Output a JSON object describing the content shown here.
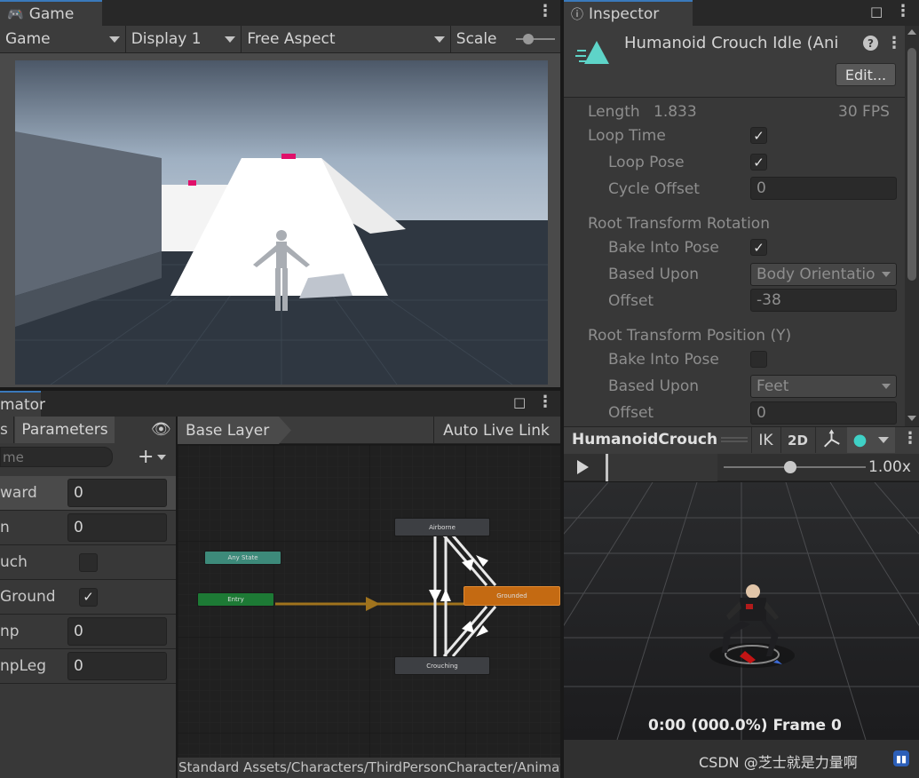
{
  "game": {
    "tab_label": "Game",
    "view_dropdown": "Game",
    "display_dropdown": "Display 1",
    "aspect_dropdown": "Free Aspect",
    "scale_label": "Scale"
  },
  "inspector": {
    "tab_label": "Inspector",
    "clip_title": "Humanoid Crouch Idle (Ani",
    "edit_button": "Edit...",
    "length_label": "Length",
    "length_value": "1.833",
    "fps_value": "30 FPS",
    "loop_time_label": "Loop Time",
    "loop_time_checked": true,
    "loop_pose_label": "Loop Pose",
    "loop_pose_checked": true,
    "cycle_offset_label": "Cycle Offset",
    "cycle_offset_value": "0",
    "rtr_header": "Root Transform Rotation",
    "rtr_bake_label": "Bake Into Pose",
    "rtr_bake_checked": true,
    "rtr_based_label": "Based Upon",
    "rtr_based_value": "Body Orientatio",
    "rtr_offset_label": "Offset",
    "rtr_offset_value": "-38",
    "rtp_header": "Root Transform Position (Y)",
    "rtp_bake_label": "Bake Into Pose",
    "rtp_bake_checked": false,
    "rtp_based_label": "Based Upon",
    "rtp_based_value": "Feet",
    "rtp_offset_label": "Offset",
    "rtp_offset_value": "0"
  },
  "preview": {
    "title": "HumanoidCrouch",
    "ik_label": "IK",
    "twod_label": "2D",
    "speed_value": "1.00x",
    "frame_readout": "0:00 (000.0%) Frame 0"
  },
  "animator": {
    "tab_label": "mator",
    "layers_tab": "s",
    "parameters_tab": "Parameters",
    "search_placeholder": "me",
    "base_layer": "Base Layer",
    "auto_live_link": "Auto Live Link",
    "params": [
      {
        "name": "ward",
        "type": "float",
        "value": "0"
      },
      {
        "name": "n",
        "type": "float",
        "value": "0"
      },
      {
        "name": "uch",
        "type": "bool",
        "checked": false
      },
      {
        "name": "Ground",
        "type": "bool",
        "checked": true
      },
      {
        "name": "np",
        "type": "float",
        "value": "0"
      },
      {
        "name": "npLeg",
        "type": "float",
        "value": "0"
      }
    ],
    "nodes": {
      "airborne": "Airborne",
      "any_state": "Any State",
      "entry": "Entry",
      "grounded": "Grounded",
      "crouching": "Crouching"
    },
    "status_path": "Standard Assets/Characters/ThirdPersonCharacter/Animat"
  },
  "watermark": "CSDN @芝士就是力量啊",
  "colors": {
    "accent_blue": "#3a79bb",
    "state_default": "#3d3f43",
    "state_entry": "#1d7a35",
    "state_any": "#3d8a7a",
    "state_grounded": "#c46a12",
    "transition_arrow": "#a0731d"
  }
}
